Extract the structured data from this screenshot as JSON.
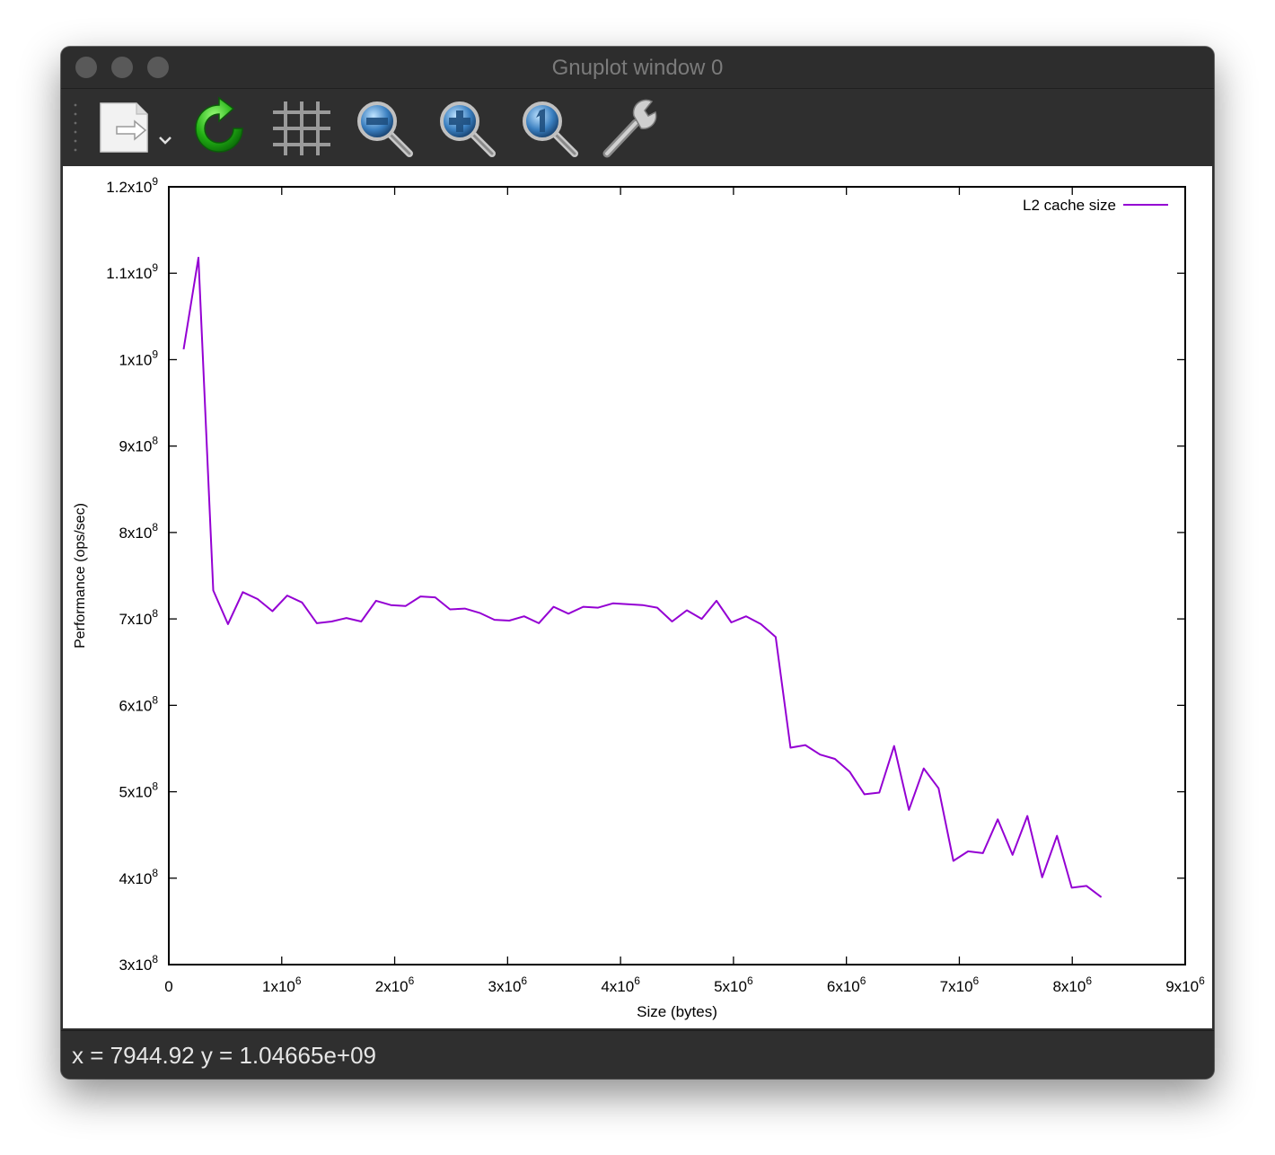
{
  "window": {
    "title": "Gnuplot window 0"
  },
  "toolbar": {
    "buttons": [
      {
        "id": "export",
        "icon": "export-document-icon"
      },
      {
        "id": "replot",
        "icon": "replot-refresh-icon"
      },
      {
        "id": "grid",
        "icon": "grid-icon"
      },
      {
        "id": "zoom_prev",
        "icon": "zoom-out-icon"
      },
      {
        "id": "zoom_next",
        "icon": "zoom-in-icon"
      },
      {
        "id": "autoscale",
        "icon": "zoom-autoscale-icon"
      },
      {
        "id": "settings",
        "icon": "wrench-icon"
      }
    ]
  },
  "status": {
    "text": "x = 7944.92 y = 1.04665e+09"
  },
  "chart_data": {
    "type": "line",
    "xlabel": "Size (bytes)",
    "ylabel": "Performance (ops/sec)",
    "xlim": [
      0,
      9000000
    ],
    "ylim": [
      300000000,
      1200000000
    ],
    "xticks": [
      {
        "value": 0,
        "base": "0",
        "exp": ""
      },
      {
        "value": 1000000,
        "base": "1x10",
        "exp": "6"
      },
      {
        "value": 2000000,
        "base": "2x10",
        "exp": "6"
      },
      {
        "value": 3000000,
        "base": "3x10",
        "exp": "6"
      },
      {
        "value": 4000000,
        "base": "4x10",
        "exp": "6"
      },
      {
        "value": 5000000,
        "base": "5x10",
        "exp": "6"
      },
      {
        "value": 6000000,
        "base": "6x10",
        "exp": "6"
      },
      {
        "value": 7000000,
        "base": "7x10",
        "exp": "6"
      },
      {
        "value": 8000000,
        "base": "8x10",
        "exp": "6"
      },
      {
        "value": 9000000,
        "base": "9x10",
        "exp": "6"
      }
    ],
    "yticks": [
      {
        "value": 300000000,
        "base": "3x10",
        "exp": "8"
      },
      {
        "value": 400000000,
        "base": "4x10",
        "exp": "8"
      },
      {
        "value": 500000000,
        "base": "5x10",
        "exp": "8"
      },
      {
        "value": 600000000,
        "base": "6x10",
        "exp": "8"
      },
      {
        "value": 700000000,
        "base": "7x10",
        "exp": "8"
      },
      {
        "value": 800000000,
        "base": "8x10",
        "exp": "8"
      },
      {
        "value": 900000000,
        "base": "9x10",
        "exp": "8"
      },
      {
        "value": 1000000000,
        "base": "1x10",
        "exp": "9"
      },
      {
        "value": 1100000000,
        "base": "1.1x10",
        "exp": "9"
      },
      {
        "value": 1200000000,
        "base": "1.2x10",
        "exp": "9"
      }
    ],
    "grid": false,
    "legend_position": "top-right",
    "series": [
      {
        "name": "L2 cache size",
        "color": "#9400d3",
        "x": [
          131072,
          262144,
          393216,
          524288,
          655360,
          786432,
          917504,
          1048576,
          1179648,
          1310720,
          1441792,
          1572864,
          1703936,
          1835008,
          1966080,
          2097152,
          2228224,
          2359296,
          2490368,
          2621440,
          2752512,
          2883584,
          3014656,
          3145728,
          3276800,
          3407872,
          3538944,
          3670016,
          3801088,
          3932160,
          4063232,
          4194304,
          4325376,
          4456448,
          4587520,
          4718592,
          4849664,
          4980736,
          5111808,
          5242880,
          5373952,
          5505024,
          5636096,
          5767168,
          5898240,
          6029312,
          6160384,
          6291456,
          6422528,
          6553600,
          6684672,
          6815744,
          6946816,
          7077888,
          7208960,
          7340032,
          7471104,
          7602176,
          7733248,
          7864320,
          7995392,
          8126464,
          8257536
        ],
        "y": [
          1012000000,
          1118000000,
          733000000,
          694000000,
          731000000,
          723000000,
          709000000,
          727000000,
          719000000,
          695000000,
          697000000,
          701000000,
          697000000,
          721000000,
          716000000,
          715000000,
          726000000,
          725000000,
          711000000,
          712000000,
          707000000,
          699000000,
          698000000,
          703000000,
          695000000,
          714000000,
          706000000,
          714000000,
          713000000,
          718000000,
          717000000,
          716000000,
          713000000,
          697000000,
          710000000,
          700000000,
          721000000,
          696000000,
          703000000,
          694000000,
          679000000,
          551000000,
          554000000,
          543000000,
          538000000,
          523000000,
          497000000,
          499000000,
          553000000,
          479000000,
          527000000,
          504000000,
          420000000,
          431000000,
          429000000,
          468000000,
          427000000,
          472000000,
          401000000,
          449000000,
          389000000,
          391000000,
          378000000
        ]
      }
    ]
  }
}
